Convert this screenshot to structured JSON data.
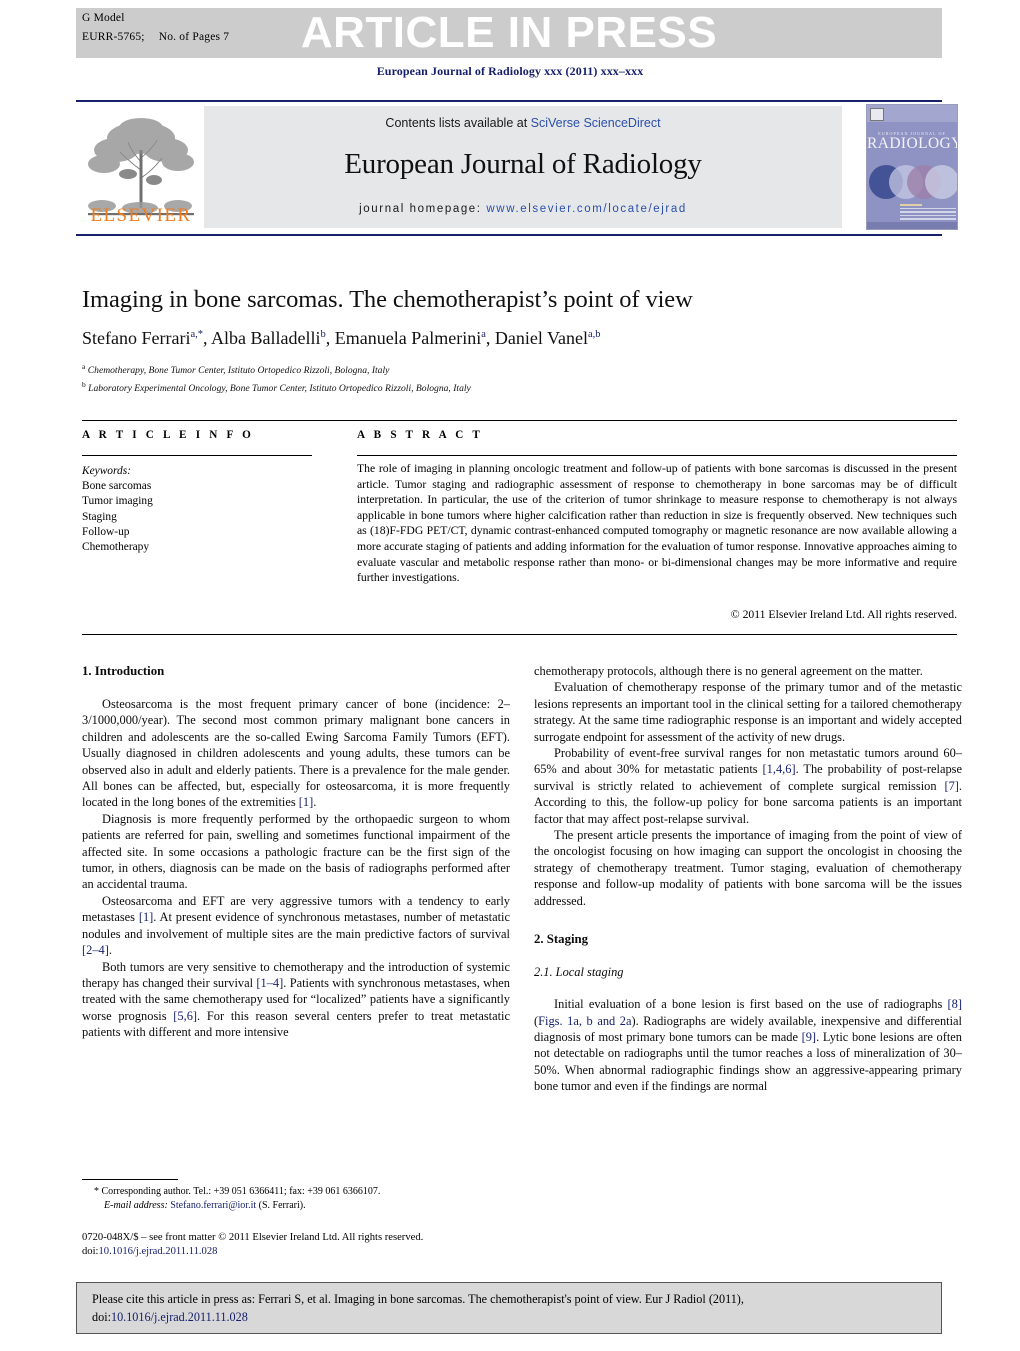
{
  "header": {
    "g_model": "G Model",
    "article_id": "EURR-5765;",
    "pages": "No. of Pages 7",
    "article_in_press": "ARTICLE IN PRESS",
    "journal_ref": "European Journal of Radiology xxx (2011) xxx–xxx"
  },
  "masthead": {
    "contents_prefix": "Contents lists available at ",
    "contents_link": "SciVerse ScienceDirect",
    "journal_title": "European Journal of Radiology",
    "homepage_prefix": "journal homepage: ",
    "homepage_url": "www.elsevier.com/locate/ejrad",
    "publisher": "ELSEVIER",
    "cover": {
      "journal_small": "EUROPEAN JOURNAL OF",
      "journal_big": "RADIOLOGY"
    },
    "colors": {
      "rule": "#17216b",
      "link": "#2b4faa",
      "elsevier_orange": "#f07c1e",
      "gray_block": "#e6e7e9",
      "band_gray": "#cccccc"
    }
  },
  "article": {
    "title": "Imaging in bone sarcomas. The chemotherapist’s point of view",
    "authors": [
      {
        "name": "Stefano Ferrari",
        "marks": "a,*"
      },
      {
        "name": "Alba Balladelli",
        "marks": "b"
      },
      {
        "name": "Emanuela Palmerini",
        "marks": "a"
      },
      {
        "name": "Daniel Vanel",
        "marks": "a,b"
      }
    ],
    "affiliations": [
      {
        "mark": "a",
        "text": "Chemotherapy, Bone Tumor Center, Istituto Ortopedico Rizzoli, Bologna, Italy"
      },
      {
        "mark": "b",
        "text": "Laboratory Experimental Oncology, Bone Tumor Center, Istituto Ortopedico Rizzoli, Bologna, Italy"
      }
    ]
  },
  "info": {
    "heading": "A R T I C L E   I N F O",
    "keywords_label": "Keywords:",
    "keywords": [
      "Bone sarcomas",
      "Tumor imaging",
      "Staging",
      "Follow-up",
      "Chemotherapy"
    ]
  },
  "abstract": {
    "heading": "A B S T R A C T",
    "text": "The role of imaging in planning oncologic treatment and follow-up of patients with bone sarcomas is discussed in the present article. Tumor staging and radiographic assessment of response to chemotherapy in bone sarcomas may be of difficult interpretation. In particular, the use of the criterion of tumor shrinkage to measure response to chemotherapy is not always applicable in bone tumors where higher calcification rather than reduction in size is frequently observed. New techniques such as (18)F-FDG PET/CT, dynamic contrast-enhanced computed tomography or magnetic resonance are now available allowing a more accurate staging of patients and adding information for the evaluation of tumor response. Innovative approaches aiming to evaluate vascular and metabolic response rather than mono- or bi-dimensional changes may be more informative and require further investigations.",
    "copyright": "© 2011 Elsevier Ireland Ltd. All rights reserved."
  },
  "body": {
    "left": {
      "section_heading": "1.  Introduction",
      "paragraphs": [
        "Osteosarcoma is the most frequent primary cancer of bone (incidence: 2–3/1000,000/year). The second most common primary malignant bone cancers in children and adolescents are the so-called Ewing Sarcoma Family Tumors (EFT). Usually diagnosed in children adolescents and young adults, these tumors can be observed also in adult and elderly patients. There is a prevalence for the male gender. All bones can be affected, but, especially for osteosarcoma, it is more frequently located in the long bones of the extremities [1].",
        "Diagnosis is more frequently performed by the orthopaedic surgeon to whom patients are referred for pain, swelling and sometimes functional impairment of the affected site. In some occasions a pathologic fracture can be the first sign of the tumor, in others, diagnosis can be made on the basis of radiographs performed after an accidental trauma.",
        "Osteosarcoma and EFT are very aggressive tumors with a tendency to early metastases [1]. At present evidence of synchronous metastases, number of metastatic nodules and involvement of multiple sites are the main predictive factors of survival [2–4].",
        "Both tumors are very sensitive to chemotherapy and the introduction of systemic therapy has changed their survival [1–4]. Patients with synchronous metastases, when treated with the same chemotherapy used for “localized” patients have a significantly worse prognosis [5,6]. For this reason several centers prefer to treat metastatic patients with different and more intensive"
      ]
    },
    "right": {
      "paragraphs_before": [
        "chemotherapy protocols, although there is no general agreement on the matter.",
        "Evaluation of chemotherapy response of the primary tumor and of the metastic lesions represents an important tool in the clinical setting for a tailored chemotherapy strategy. At the same time radiographic response is an important and widely accepted surrogate endpoint for assessment of the activity of new drugs.",
        "Probability of event-free survival ranges for non metastatic tumors around 60–65% and about 30% for metastatic patients [1,4,6]. The probability of post-relapse survival is strictly related to achievement of complete surgical remission [7]. According to this, the follow-up policy for bone sarcoma patients is an important factor that may affect post-relapse survival.",
        "The present article presents the importance of imaging from the point of view of the oncologist focusing on how imaging can support the oncologist in choosing the strategy of chemotherapy treatment. Tumor staging, evaluation of chemotherapy response and follow-up modality of patients with bone sarcoma will be the issues addressed."
      ],
      "section_heading": "2.  Staging",
      "subsection_heading": "2.1.  Local staging",
      "paragraphs_after": [
        "Initial evaluation of a bone lesion is first based on the use of radiographs [8] (Figs. 1a, b and 2a). Radiographs are widely available, inexpensive and differential diagnosis of most primary bone tumors can be made [9]. Lytic bone lesions are often not detectable on radiographs until the tumor reaches a loss of mineralization of 30–50%. When abnormal radiographic findings show an aggressive-appearing primary bone tumor and even if the findings are normal"
      ]
    }
  },
  "footnote": {
    "corresponding": "* Corresponding author. Tel.: +39 051 6366411; fax: +39 061 6366107.",
    "email_label": "E-mail address:",
    "email": "Stefano.ferrari@ior.it",
    "email_suffix": "(S. Ferrari).",
    "frontmatter": "0720-048X/$ – see front matter © 2011 Elsevier Ireland Ltd. All rights reserved.",
    "doi_label": "doi:",
    "doi": "10.1016/j.ejrad.2011.11.028"
  },
  "citation": {
    "text": "Please cite this article in press as: Ferrari S, et al. Imaging in bone sarcomas. The chemotherapist's point of view. Eur J Radiol (2011),",
    "doi_label": "doi:",
    "doi": "10.1016/j.ejrad.2011.11.028"
  }
}
